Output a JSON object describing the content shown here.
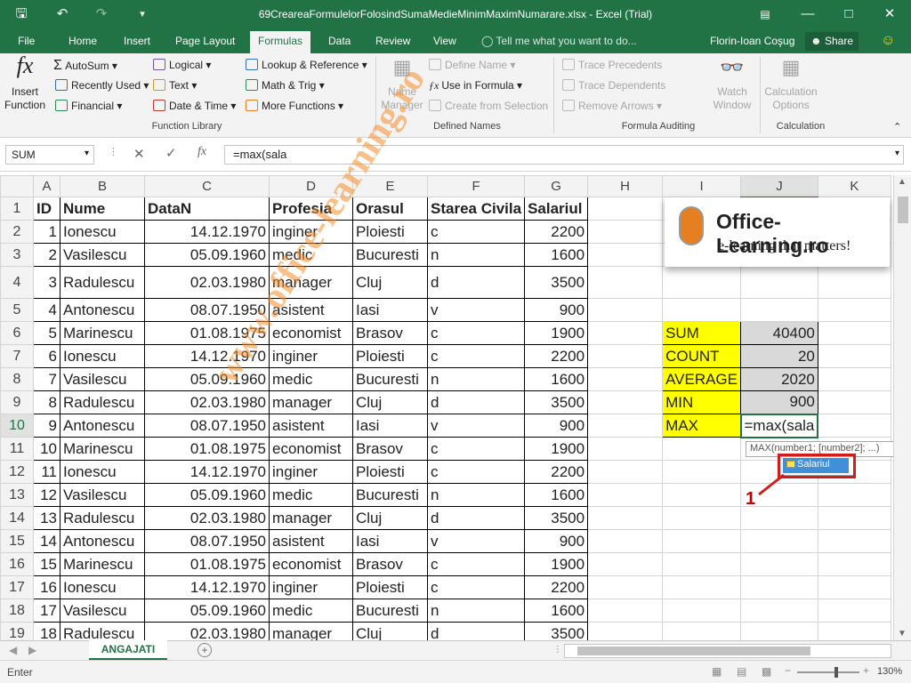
{
  "titlebar": {
    "title": "69CreareaFormulelorFolosindSumaMedieMinimMaximNumarare.xlsx - Excel (Trial)",
    "save_icon": "save-icon",
    "undo_icon": "undo-icon",
    "redo_icon": "redo-icon"
  },
  "tabs": [
    "File",
    "Home",
    "Insert",
    "Page Layout",
    "Formulas",
    "Data",
    "Review",
    "View"
  ],
  "tell_me": "Tell me what you want to do...",
  "user": "Florin-Ioan Coşug",
  "share": "Share",
  "ribbon": {
    "insert_function": "Insert Function",
    "autosum": "AutoSum",
    "recently_used": "Recently Used",
    "financial": "Financial",
    "logical": "Logical",
    "text": "Text",
    "date_time": "Date & Time",
    "lookup": "Lookup & Reference",
    "math": "Math & Trig",
    "more": "More Functions",
    "function_library": "Function Library",
    "name_manager": "Name Manager",
    "define_name": "Define Name",
    "use_in_formula": "Use in Formula",
    "create_from_selection": "Create from Selection",
    "defined_names": "Defined Names",
    "trace_precedents": "Trace Precedents",
    "trace_dependents": "Trace Dependents",
    "remove_arrows": "Remove Arrows",
    "watch_window": "Watch Window",
    "formula_auditing": "Formula Auditing",
    "calc_options": "Calculation Options",
    "calculation": "Calculation"
  },
  "formula_bar": {
    "name_box": "SUM",
    "formula": "=max(sala",
    "fx": "fx"
  },
  "columns": [
    "A",
    "B",
    "C",
    "D",
    "E",
    "F",
    "G",
    "H",
    "I",
    "J",
    "K"
  ],
  "rows": [
    {
      "n": "1",
      "a": "ID",
      "b": "Nume",
      "c": "DataN",
      "d": "Profesia",
      "e": "Orasul",
      "f": "Starea Civila",
      "g": "Salariul"
    },
    {
      "n": "2",
      "a": "1",
      "b": "Ionescu",
      "c": "14.12.1970",
      "d": "inginer",
      "e": "Ploiesti",
      "f": "c",
      "g": "2200"
    },
    {
      "n": "3",
      "a": "2",
      "b": "Vasilescu",
      "c": "05.09.1960",
      "d": "medic",
      "e": "Bucuresti",
      "f": "n",
      "g": "1600"
    },
    {
      "n": "4",
      "a": "3",
      "b": "Radulescu",
      "c": "02.03.1980",
      "d": "manager",
      "e": "Cluj",
      "f": "d",
      "g": "3500"
    },
    {
      "n": "5",
      "a": "4",
      "b": "Antonescu",
      "c": "08.07.1950",
      "d": "asistent",
      "e": "Iasi",
      "f": "v",
      "g": "900"
    },
    {
      "n": "6",
      "a": "5",
      "b": "Marinescu",
      "c": "01.08.1975",
      "d": "economist",
      "e": "Brasov",
      "f": "c",
      "g": "1900"
    },
    {
      "n": "7",
      "a": "6",
      "b": "Ionescu",
      "c": "14.12.1970",
      "d": "inginer",
      "e": "Ploiesti",
      "f": "c",
      "g": "2200"
    },
    {
      "n": "8",
      "a": "7",
      "b": "Vasilescu",
      "c": "05.09.1960",
      "d": "medic",
      "e": "Bucuresti",
      "f": "n",
      "g": "1600"
    },
    {
      "n": "9",
      "a": "8",
      "b": "Radulescu",
      "c": "02.03.1980",
      "d": "manager",
      "e": "Cluj",
      "f": "d",
      "g": "3500"
    },
    {
      "n": "10",
      "a": "9",
      "b": "Antonescu",
      "c": "08.07.1950",
      "d": "asistent",
      "e": "Iasi",
      "f": "v",
      "g": "900"
    },
    {
      "n": "11",
      "a": "10",
      "b": "Marinescu",
      "c": "01.08.1975",
      "d": "economist",
      "e": "Brasov",
      "f": "c",
      "g": "1900"
    },
    {
      "n": "12",
      "a": "11",
      "b": "Ionescu",
      "c": "14.12.1970",
      "d": "inginer",
      "e": "Ploiesti",
      "f": "c",
      "g": "2200"
    },
    {
      "n": "13",
      "a": "12",
      "b": "Vasilescu",
      "c": "05.09.1960",
      "d": "medic",
      "e": "Bucuresti",
      "f": "n",
      "g": "1600"
    },
    {
      "n": "14",
      "a": "13",
      "b": "Radulescu",
      "c": "02.03.1980",
      "d": "manager",
      "e": "Cluj",
      "f": "d",
      "g": "3500"
    },
    {
      "n": "15",
      "a": "14",
      "b": "Antonescu",
      "c": "08.07.1950",
      "d": "asistent",
      "e": "Iasi",
      "f": "v",
      "g": "900"
    },
    {
      "n": "16",
      "a": "15",
      "b": "Marinescu",
      "c": "01.08.1975",
      "d": "economist",
      "e": "Brasov",
      "f": "c",
      "g": "1900"
    },
    {
      "n": "17",
      "a": "16",
      "b": "Ionescu",
      "c": "14.12.1970",
      "d": "inginer",
      "e": "Ploiesti",
      "f": "c",
      "g": "2200"
    },
    {
      "n": "18",
      "a": "17",
      "b": "Vasilescu",
      "c": "05.09.1960",
      "d": "medic",
      "e": "Bucuresti",
      "f": "n",
      "g": "1600"
    },
    {
      "n": "19",
      "a": "18",
      "b": "Radulescu",
      "c": "02.03.1980",
      "d": "manager",
      "e": "Cluj",
      "f": "d",
      "g": "3500"
    }
  ],
  "summary": [
    {
      "label": "SUM",
      "value": "40400"
    },
    {
      "label": "COUNT",
      "value": "20"
    },
    {
      "label": "AVERAGE",
      "value": "2020"
    },
    {
      "label": "MIN",
      "value": "900"
    },
    {
      "label": "MAX",
      "value": "=max(sala"
    }
  ],
  "logo": {
    "title": "Office-Learning.ro",
    "tagline": "e-learning that matters!"
  },
  "tooltip": "MAX(number1; [number2]; ...)",
  "autocomplete": "Salariul",
  "callout": "1",
  "watermark": "www.office-learning.ro",
  "sheet_tab": "ANGAJATI",
  "status": "Enter",
  "zoom": "130%",
  "colors": {
    "excel_green": "#217346",
    "yellow": "#ffff00",
    "red": "#d11c1c"
  }
}
